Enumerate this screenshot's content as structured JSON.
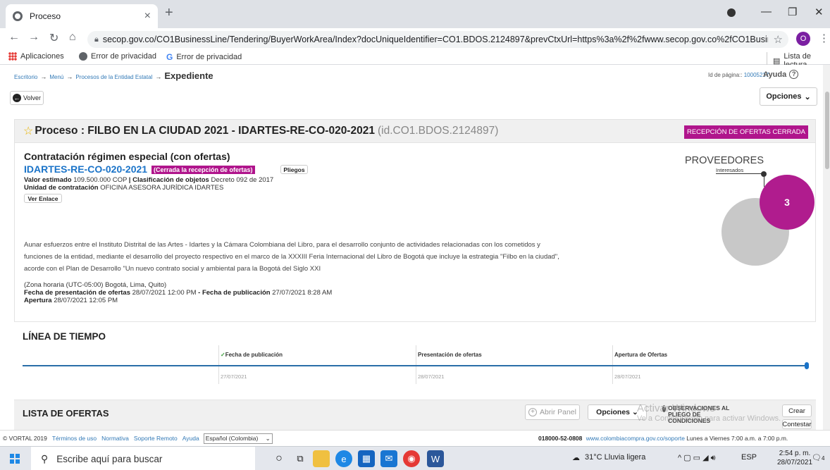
{
  "browser": {
    "tab_title": "Proceso",
    "tab_close": "×",
    "new_tab": "+",
    "url": "secop.gov.co/CO1BusinessLine/Tendering/BuyerWorkArea/Index?docUniqueIdentifier=CO1.BDOS.2124897&prevCtxUrl=https%3a%2f%2fwww.secop.gov.co%2fCO1Business...",
    "avatar_letter": "O",
    "bookmarks": [
      "Aplicaciones",
      "Error de privacidad",
      "Error de privacidad"
    ],
    "reading_list": "Lista de lectura"
  },
  "breadcrumb": {
    "items": [
      "Escritorio",
      "Menú",
      "Procesos de la Entidad Estatal"
    ],
    "current": "Expediente"
  },
  "page_id": {
    "label": "Id de página::",
    "value": "10005217"
  },
  "help_label": "Ayuda",
  "back_label": "Volver",
  "options_label": "Opciones",
  "process": {
    "title": "Proceso : FILBO EN LA CIUDAD 2021 - IDARTES-RE-CO-020-2021",
    "id": "(id.CO1.BDOS.2124897)",
    "status": "RECEPCIÓN DE OFERTAS CERRADA",
    "contract_type": "Contratación régimen especial (con ofertas)",
    "reference": "IDARTES-RE-CO-020-2021",
    "closed_badge": "(Cerrada la recepción de ofertas)",
    "pliegos_button": "Pliegos",
    "value_label": "Valor estimado",
    "value": "109.500.000 COP",
    "classification_label": "Clasificación de objetos",
    "classification": "Decreto 092 de 2017",
    "unit_label": "Unidad de contratación",
    "unit": "OFICINA ASESORA JURÍDICA IDARTES",
    "link_button": "Ver Enlace",
    "description": "Aunar esfuerzos entre el Instituto Distrital de las Artes - Idartes y la Cámara Colombiana del Libro, para el desarrollo conjunto de actividades relacionadas con los cometidos y funciones de la entidad, mediante el desarrollo del proyecto respectivo en el marco de la XXXIII Feria Internacional del Libro de Bogotá que incluye la estrategia \"Filbo en la ciudad\", acorde con el Plan de Desarrollo \"Un nuevo contrato social y ambiental para la Bogotá del Siglo XXI",
    "timezone": "(Zona horaria (UTC-05:00) Bogotá, Lima, Quito)",
    "offers_date_label": "Fecha de presentación de ofertas",
    "offers_date": "28/07/2021 12:00 PM",
    "pub_date_label": "Fecha de publicación",
    "pub_date": "27/07/2021 8:28 AM",
    "opening_label": "Apertura",
    "opening": "28/07/2021 12:05 PM"
  },
  "providers": {
    "title": "PROVEEDORES",
    "subtitle": "Interesados",
    "count": "3"
  },
  "timeline": {
    "title": "LÍNEA DE TIEMPO",
    "steps": [
      {
        "label": "Fecha de publicación",
        "date": "27/07/2021"
      },
      {
        "label": "Presentación de ofertas",
        "date": "28/07/2021"
      },
      {
        "label": "Apertura de Ofertas",
        "date": "28/07/2021"
      }
    ]
  },
  "offers": {
    "title": "LISTA DE OFERTAS",
    "open_panel": "Abrir Panel",
    "options": "Opciones",
    "observations": "OBSERVACIONES AL PLIEGO DE CONDICIONES",
    "create": "Crear",
    "answer": "Contestar"
  },
  "watermark": {
    "line1": "Activar Windows",
    "line2": "Ve a Configuración para activar Windows."
  },
  "footer": {
    "copyright": "© VORTAL 2019",
    "links": [
      "Términos de uso",
      "Normativa",
      "Soporte Remoto",
      "Ayuda"
    ],
    "language": "Español (Colombia)",
    "phone": "018000-52-0808",
    "support_url": "www.colombiacompra.gov.co/soporte",
    "hours": "Lunes a Viernes 7:00 a.m. a 7:00 p.m."
  },
  "taskbar": {
    "search": "Escribe aquí para buscar",
    "weather": "31°C Lluvia ligera",
    "lang": "ESP",
    "time": "2:54 p. m.",
    "date": "28/07/2021",
    "notifications": "4"
  },
  "colors": {
    "magenta": "#b0158c",
    "link": "#1a73c8",
    "timeline": "#2a6ea8"
  }
}
